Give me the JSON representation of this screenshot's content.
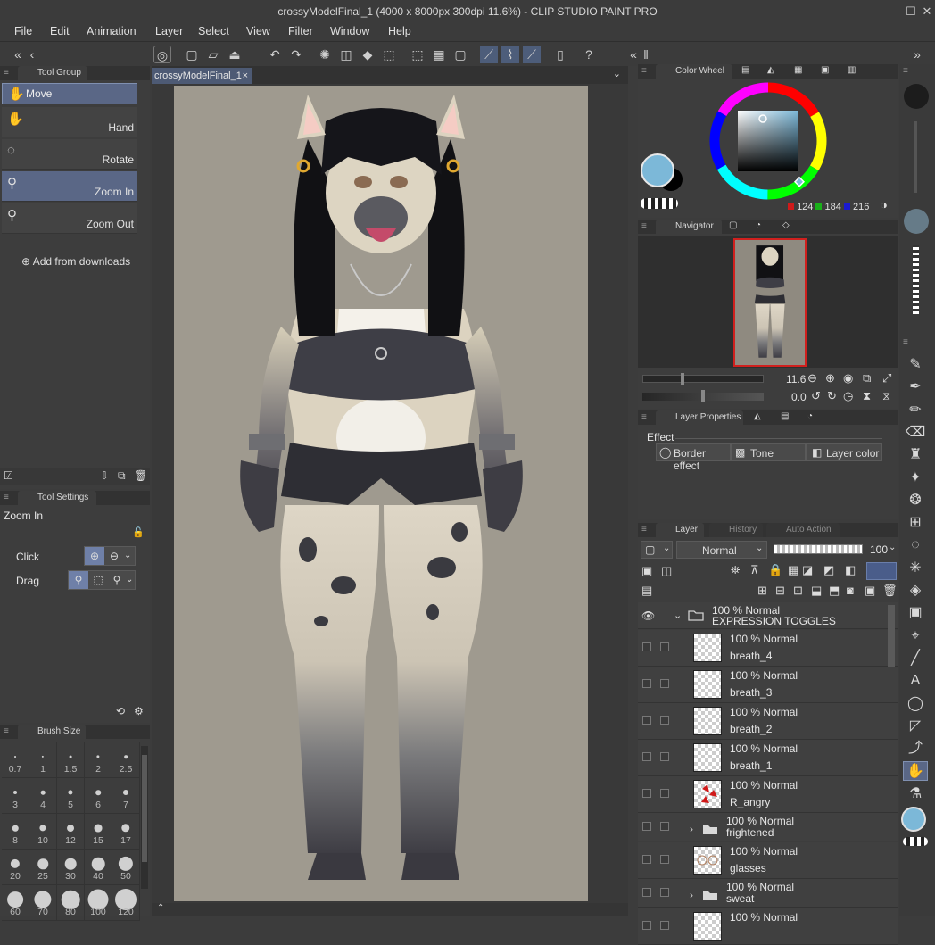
{
  "window": {
    "title": "crossyModelFinal_1 (4000 x 8000px 300dpi 11.6%) - CLIP STUDIO PAINT PRO"
  },
  "menu": [
    "File",
    "Edit",
    "Animation",
    "Layer",
    "Select",
    "View",
    "Filter",
    "Window",
    "Help"
  ],
  "document_tab": "crossyModelFinal_1",
  "tool_group": {
    "tab": "Tool Group",
    "tools": [
      {
        "label": "Move",
        "icon": "move-icon"
      },
      {
        "label": "Hand",
        "icon": "hand-icon"
      },
      {
        "label": "Rotate",
        "icon": "rotate-icon"
      },
      {
        "label": "Zoom In",
        "icon": "zoom-in-icon"
      },
      {
        "label": "Zoom Out",
        "icon": "zoom-out-icon"
      }
    ],
    "add_from_downloads": "Add from downloads"
  },
  "tool_settings": {
    "tab": "Tool Settings",
    "tool_name": "Zoom In",
    "click_label": "Click",
    "drag_label": "Drag"
  },
  "brush_size": {
    "tab": "Brush Size",
    "sizes": [
      "0.7",
      "1",
      "1.5",
      "2",
      "2.5",
      "3",
      "4",
      "5",
      "6",
      "7",
      "8",
      "10",
      "12",
      "15",
      "17",
      "20",
      "25",
      "30",
      "40",
      "50",
      "60",
      "70",
      "80",
      "100",
      "120"
    ]
  },
  "color_wheel": {
    "tab": "Color Wheel",
    "r": "124",
    "g": "184",
    "b": "216",
    "main_color": "#7cb8d8"
  },
  "navigator": {
    "tab": "Navigator",
    "zoom": "11.6",
    "rotation": "0.0"
  },
  "layer_properties": {
    "tab": "Layer Properties",
    "section": "Effect",
    "border_effect": "Border effect",
    "tone": "Tone",
    "layer_color": "Layer color"
  },
  "layer_panel": {
    "tabs": [
      "Layer",
      "History",
      "Auto Action"
    ],
    "blend_mode": "Normal",
    "opacity": "100",
    "layers": [
      {
        "mode": "100 % Normal",
        "name": "EXPRESSION TOGGLES",
        "type": "folder",
        "visible": true
      },
      {
        "mode": "100 % Normal",
        "name": "breath_4",
        "type": "layer"
      },
      {
        "mode": "100 % Normal",
        "name": "breath_3",
        "type": "layer"
      },
      {
        "mode": "100 % Normal",
        "name": "breath_2",
        "type": "layer"
      },
      {
        "mode": "100 % Normal",
        "name": "breath_1",
        "type": "layer"
      },
      {
        "mode": "100 % Normal",
        "name": "R_angry",
        "type": "layer"
      },
      {
        "mode": "100 % Normal",
        "name": "frightened",
        "type": "folder"
      },
      {
        "mode": "100 % Normal",
        "name": "glasses",
        "type": "layer"
      },
      {
        "mode": "100 % Normal",
        "name": "sweat",
        "type": "folder"
      },
      {
        "mode": "100 % Normal",
        "name": "",
        "type": "layer"
      }
    ]
  },
  "colors": {
    "accent": "#5a6786",
    "canvas_bg": "#9f9a8f",
    "navigator_frame": "#d0201e"
  }
}
